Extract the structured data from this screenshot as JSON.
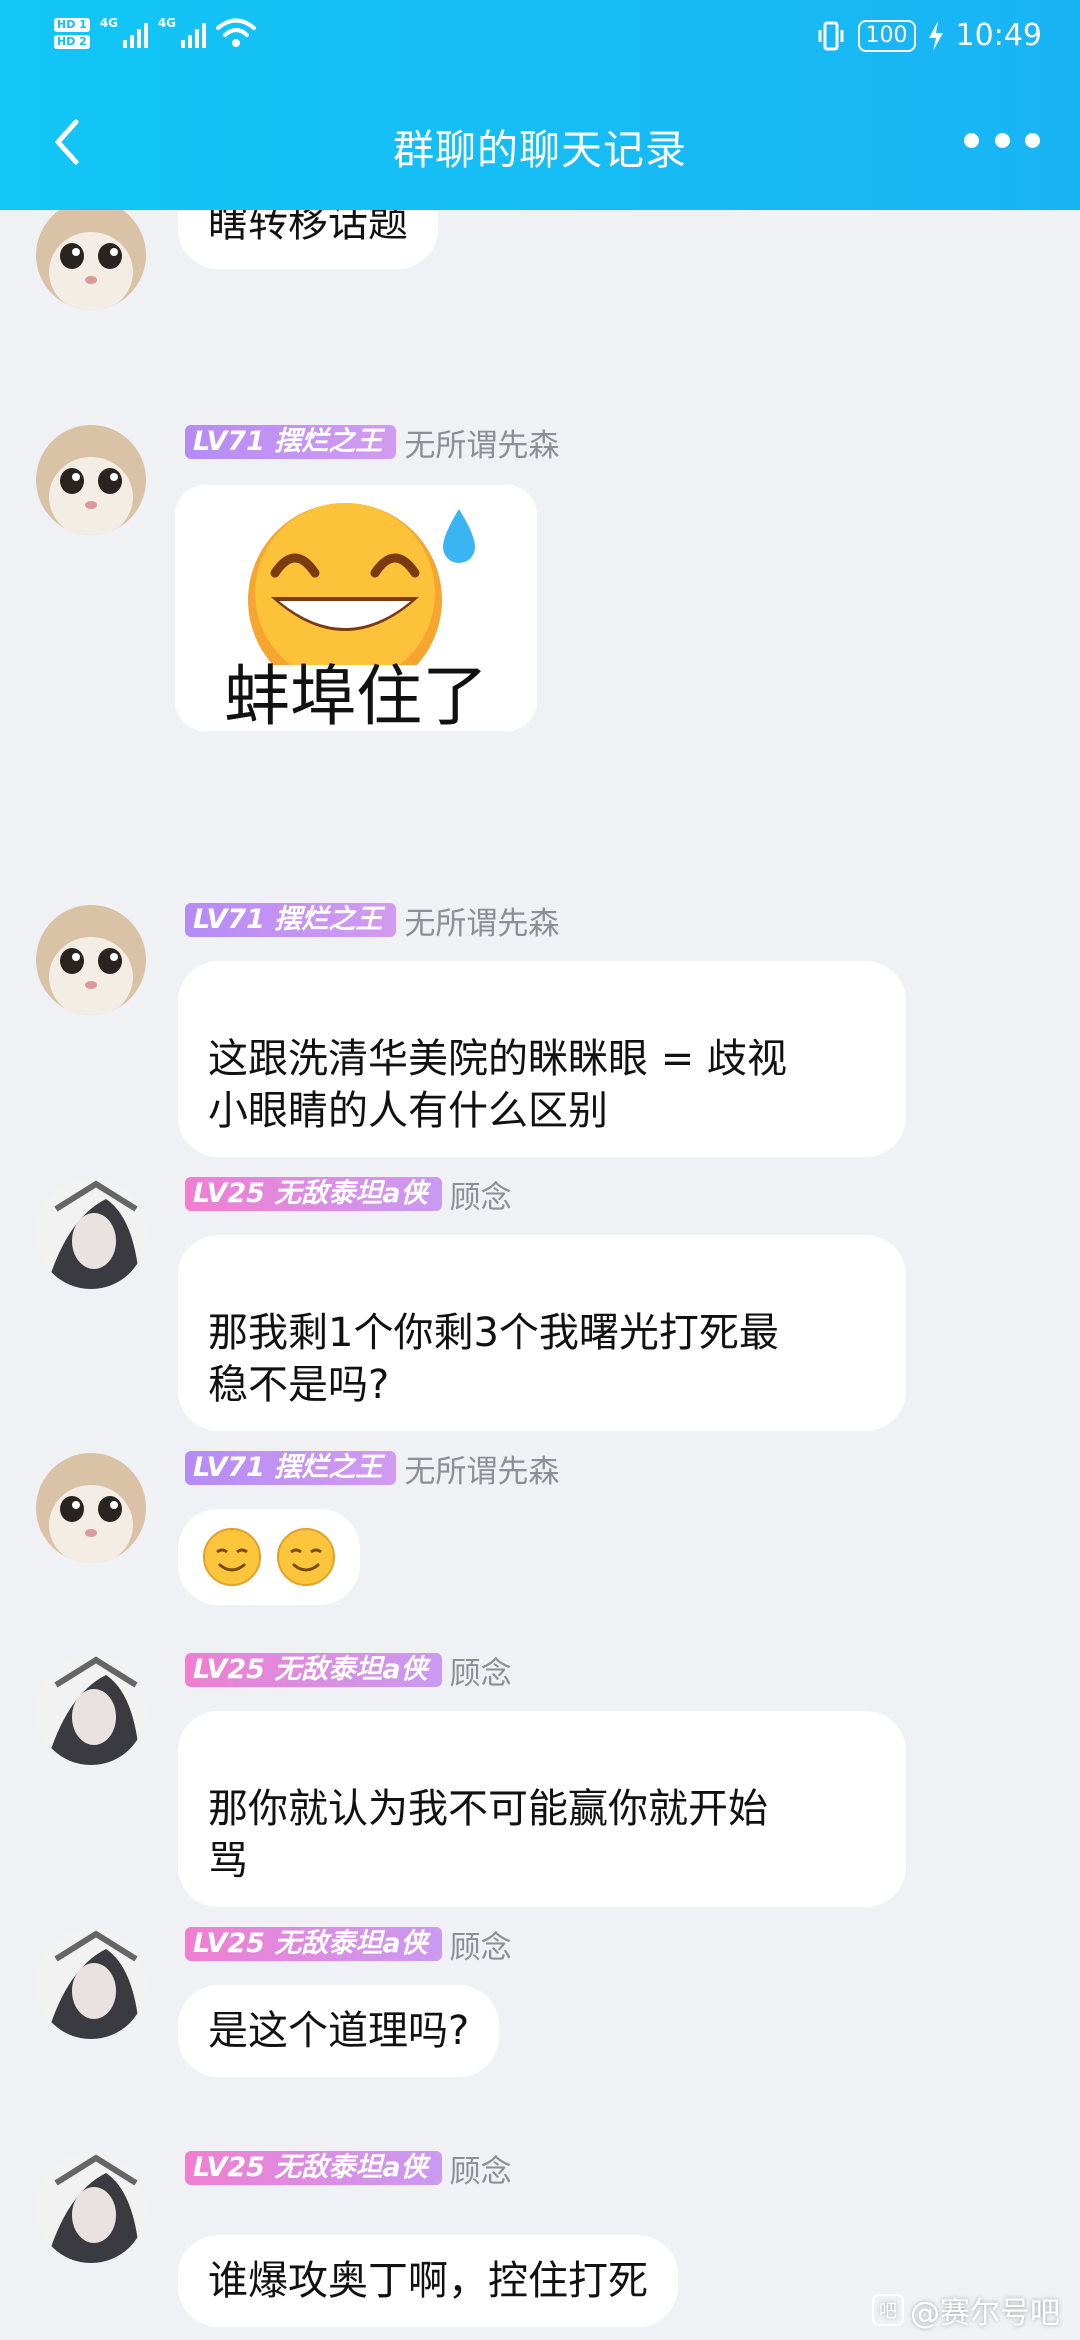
{
  "status_bar": {
    "sim1": "HD 1",
    "sim2": "HD 2",
    "net1": "4G",
    "net2": "4G",
    "battery": "100",
    "time": "10:49"
  },
  "header": {
    "title": "群聊的聊天记录"
  },
  "users": {
    "u1": {
      "badge": "LV71 摆烂之王",
      "name": "无所谓先森"
    },
    "u2": {
      "badge": "LV25 无敌泰坦a侠",
      "name": "顾念"
    }
  },
  "messages": [
    {
      "text": "瞎转移话题"
    },
    {
      "sticker_text": "蚌埠住了"
    },
    {
      "text": "这跟洗清华美院的眯眯眼 = 歧视\n小眼睛的人有什么区别"
    },
    {
      "text": "那我剩1个你剩3个我曙光打死最\n稳不是吗?"
    },
    {
      "emoji": [
        "smiling-face-icon",
        "smiling-face-icon"
      ]
    },
    {
      "text": "那你就认为我不可能赢你就开始\n骂"
    },
    {
      "text": "是这个道理吗?"
    },
    {
      "text": "谁爆攻奥丁啊，控住打死"
    }
  ],
  "watermark": "@赛尔号吧",
  "colors": {
    "header": "#14bdf5",
    "background": "#f0f1f5",
    "bubble": "#ffffff"
  }
}
